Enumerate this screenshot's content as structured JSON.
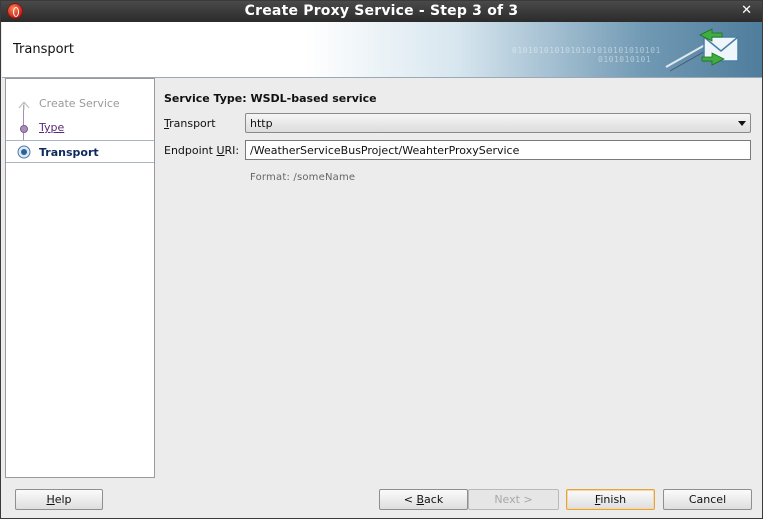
{
  "window": {
    "title": "Create Proxy Service - Step 3 of 3",
    "close_glyph": "✕"
  },
  "banner": {
    "title": "Transport",
    "binary_line1": "0101010101010101010101010101",
    "binary_line2": "0101010101",
    "icon": "mail-exchange-icon"
  },
  "steps": [
    {
      "label": "Create Service",
      "state": "completed-disabled"
    },
    {
      "label": "Type",
      "state": "link"
    },
    {
      "label": "Transport",
      "state": "current"
    }
  ],
  "form": {
    "service_type": "Service Type: WSDL-based service",
    "transport_label_mnemonic": "T",
    "transport_label_rest": "ransport",
    "transport_value": "http",
    "endpoint_label_pre": "Endpoint ",
    "endpoint_label_mnemonic": "U",
    "endpoint_label_post": "RI:",
    "endpoint_value": "/WeatherServiceBusProject/WeahterProxyService",
    "format_hint": "Format:  /someName"
  },
  "buttons": {
    "help_m": "H",
    "help_rest": "elp",
    "back_pre": "< ",
    "back_m": "B",
    "back_rest": "ack",
    "next": "Next >",
    "finish_m": "F",
    "finish_rest": "inish",
    "cancel": "Cancel"
  },
  "colors": {
    "titlebar": "#2b2b2b",
    "current_step": "#0e2a5c",
    "visited_step": "#5a2a7a",
    "finish_focus": "#e3a446"
  }
}
